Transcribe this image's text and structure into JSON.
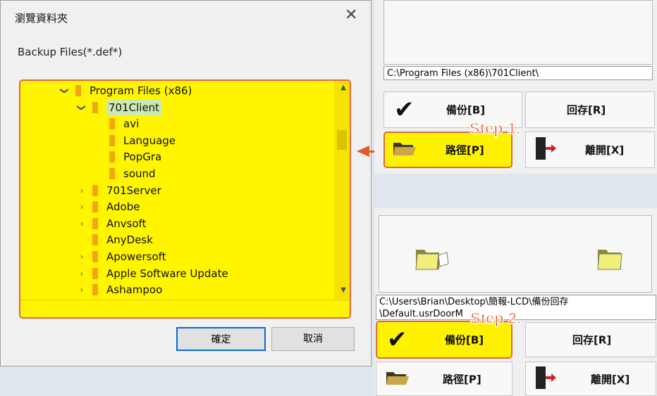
{
  "dialog": {
    "title": "瀏覽資料夾",
    "close_glyph": "✕",
    "subtitle": "Backup Files(*.def*)",
    "tree": [
      {
        "label": "Program Files (x86)",
        "expander": "expanded",
        "level": 0
      },
      {
        "label": "701Client",
        "expander": "expanded",
        "level": 1,
        "selected": true
      },
      {
        "label": "avi",
        "expander": "none",
        "level": 2
      },
      {
        "label": "Language",
        "expander": "none",
        "level": 2
      },
      {
        "label": "PopGra",
        "expander": "none",
        "level": 2
      },
      {
        "label": "sound",
        "expander": "none",
        "level": 2
      },
      {
        "label": "701Server",
        "expander": "collapsed",
        "level": 1
      },
      {
        "label": "Adobe",
        "expander": "collapsed",
        "level": 1
      },
      {
        "label": "Anvsoft",
        "expander": "collapsed",
        "level": 1
      },
      {
        "label": "AnyDesk",
        "expander": "none",
        "level": 1
      },
      {
        "label": "Apowersoft",
        "expander": "collapsed",
        "level": 1
      },
      {
        "label": "Apple Software Update",
        "expander": "collapsed",
        "level": 1
      },
      {
        "label": "Ashampoo",
        "expander": "collapsed",
        "level": 1
      }
    ],
    "ok_label": "確定",
    "cancel_label": "取消"
  },
  "panel1": {
    "path": "C:\\Program Files (x86)\\701Client\\",
    "backup_label": "備份[B]",
    "restore_label": "回存[R]",
    "path_button_label": "路徑[P]",
    "exit_label": "離開[X]",
    "step": "Step 1."
  },
  "panel2": {
    "path": "C:\\Users\\Brian\\Desktop\\簡報-LCD\\備份回存\n\\Default.usrDoorM",
    "backup_label": "備份[B]",
    "restore_label": "回存[R]",
    "path_button_label": "路徑[P]",
    "exit_label": "離開[X]",
    "step": "Step 2."
  },
  "colors": {
    "highlight": "#fff200",
    "annotation": "#e9551f",
    "folder": "#f5a416"
  }
}
